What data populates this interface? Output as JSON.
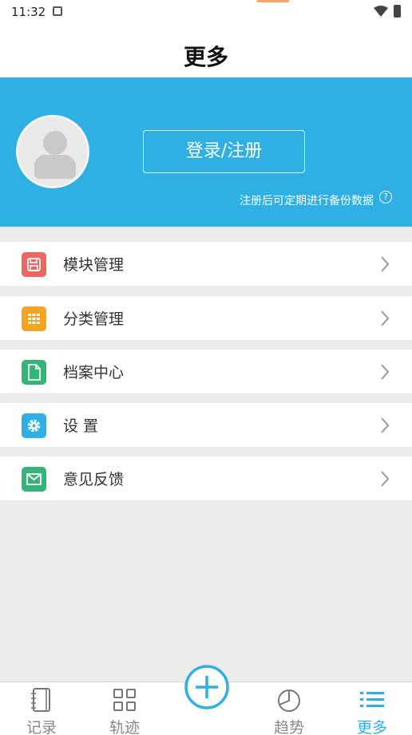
{
  "status_bar": {
    "time": "11:32"
  },
  "header": {
    "title": "更多"
  },
  "profile": {
    "login_label": "登录/注册",
    "backup_hint": "注册后可定期进行备份数据"
  },
  "menu": {
    "items": [
      {
        "label": "模块管理",
        "icon": "save-icon",
        "color": "#ee6663"
      },
      {
        "label": "分类管理",
        "icon": "grid-icon",
        "color": "#f4a322"
      },
      {
        "label": "档案中心",
        "icon": "document-icon",
        "color": "#34b479"
      },
      {
        "label": "设 置",
        "icon": "gear-icon",
        "color": "#2eb0e4"
      },
      {
        "label": "意见反馈",
        "icon": "mail-icon",
        "color": "#34b479"
      }
    ]
  },
  "bottom_nav": {
    "items": [
      {
        "label": "记录",
        "icon": "notebook-icon"
      },
      {
        "label": "轨迹",
        "icon": "four-squares-icon"
      },
      {
        "label": "趋势",
        "icon": "pie-chart-icon"
      },
      {
        "label": "更多",
        "icon": "list-icon",
        "active": true
      }
    ],
    "active_color": "#2eb0e4"
  }
}
